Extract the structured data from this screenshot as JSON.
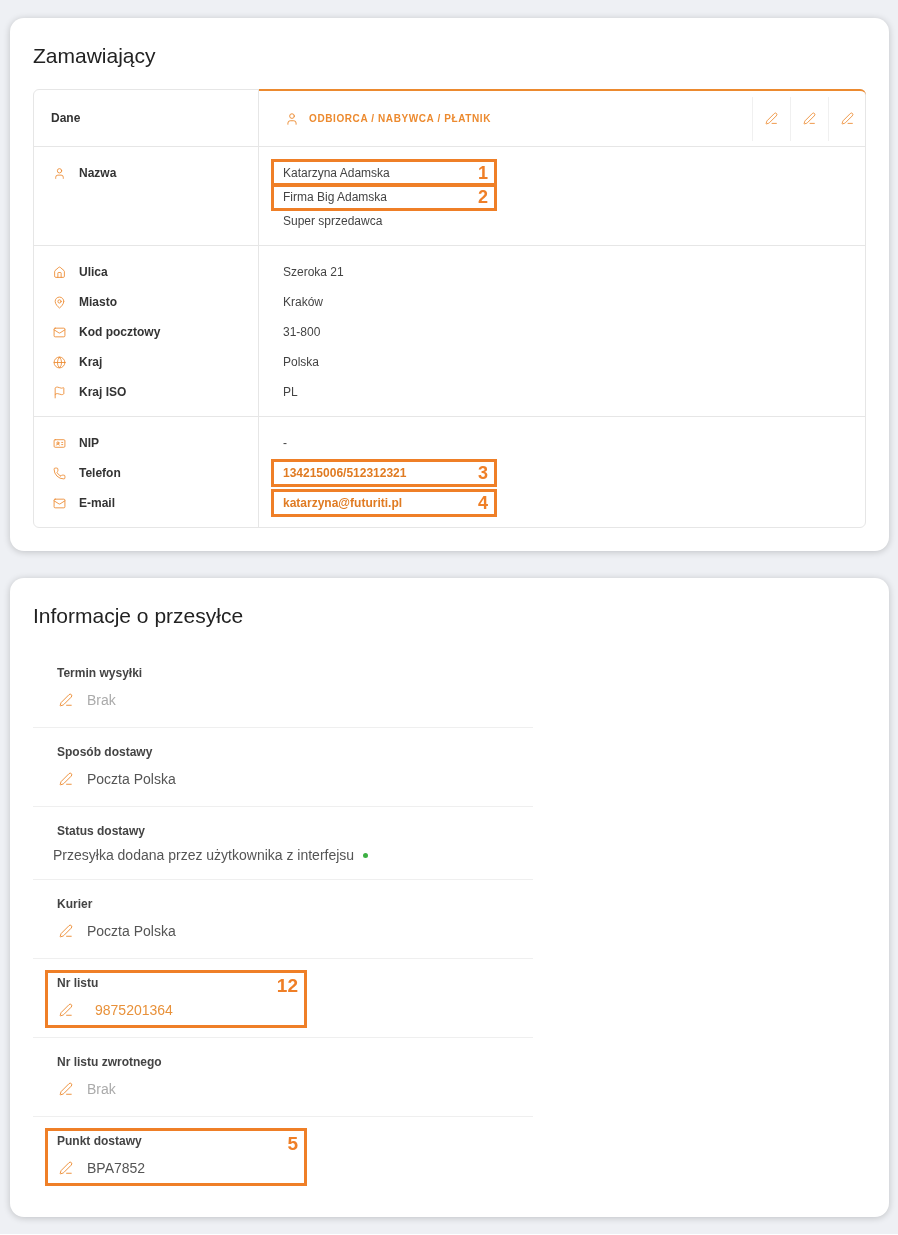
{
  "customer": {
    "title": "Zamawiający",
    "header": {
      "label": "Dane",
      "party": "ODBIORCA / NABYWCA / PŁATNIK",
      "actions": [
        {
          "kind": "edit"
        },
        {
          "kind": "edit"
        },
        {
          "kind": "edit"
        }
      ]
    },
    "sections": [
      {
        "rows": [
          {
            "kind": "name",
            "label": "Nazwa",
            "values": [
              {
                "text": "Katarzyna Adamska",
                "link": false,
                "callout": "1"
              },
              {
                "text": "Firma Big Adamska",
                "link": false,
                "callout": "2"
              },
              {
                "text": "Super sprzedawca",
                "link": false
              }
            ]
          }
        ]
      },
      {
        "rows": [
          {
            "kind": "street",
            "label": "Ulica",
            "values": [
              {
                "text": "Szeroka 21",
                "link": false
              }
            ]
          },
          {
            "kind": "city",
            "label": "Miasto",
            "values": [
              {
                "text": "Kraków",
                "link": false
              }
            ]
          },
          {
            "kind": "postcode",
            "label": "Kod pocztowy",
            "values": [
              {
                "text": "31-800",
                "link": false
              }
            ]
          },
          {
            "kind": "country",
            "label": "Kraj",
            "values": [
              {
                "text": "Polska",
                "link": false
              }
            ]
          },
          {
            "kind": "iso",
            "label": "Kraj ISO",
            "values": [
              {
                "text": "PL",
                "link": false
              }
            ]
          }
        ]
      },
      {
        "rows": [
          {
            "kind": "taxid",
            "label": "NIP",
            "values": [
              {
                "text": "-",
                "link": false
              }
            ]
          },
          {
            "kind": "phone",
            "label": "Telefon",
            "values": [
              {
                "text": "134215006/512312321",
                "link": true,
                "callout": "3"
              }
            ]
          },
          {
            "kind": "email",
            "label": "E-mail",
            "values": [
              {
                "text": "katarzyna@futuriti.pl",
                "link": true,
                "callout": "4"
              }
            ]
          }
        ]
      }
    ]
  },
  "shipping": {
    "title": "Informacje o przesyłce",
    "rows": [
      {
        "kind": "editable",
        "label": "Termin wysyłki",
        "value": "Brak",
        "empty": true,
        "highlighted": false
      },
      {
        "kind": "editable",
        "label": "Sposób dostawy",
        "value": "Poczta Polska",
        "empty": false,
        "highlighted": false
      },
      {
        "kind": "status",
        "label": "Status dostawy",
        "value": "Przesyłka dodana przez użytkownika z interfejsu",
        "empty": false,
        "highlighted": false,
        "color": "#3cb043"
      },
      {
        "kind": "editable",
        "label": "Kurier",
        "value": "Poczta Polska",
        "empty": false,
        "highlighted": false
      },
      {
        "kind": "editable",
        "label": "Nr listu",
        "value": "9875201364",
        "empty": false,
        "highlighted": true,
        "callout": "12"
      },
      {
        "kind": "editable",
        "label": "Nr listu zwrotnego",
        "value": "Brak",
        "empty": true,
        "highlighted": false
      },
      {
        "kind": "editable",
        "label": "Punkt dostawy",
        "value": "BPA7852",
        "empty": false,
        "highlighted": false,
        "callout": "5"
      }
    ]
  }
}
